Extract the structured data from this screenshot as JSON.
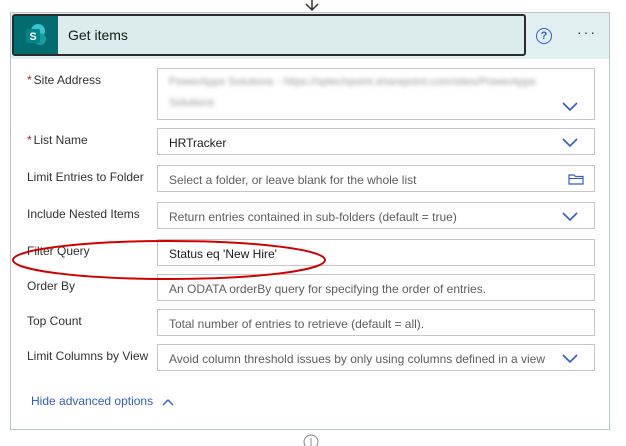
{
  "action": {
    "title": "Get items",
    "icon": "sharepoint-icon",
    "help_symbol": "?",
    "more_symbol": "···"
  },
  "fields": {
    "site_address": {
      "label": "Site Address",
      "required": true,
      "value_line1": "PowerApps Solutions - https://sptechpoint.sharepoint.com/sites/PowerApps",
      "value_line2": "Solutions"
    },
    "list_name": {
      "label": "List Name",
      "required": true,
      "value": "HRTracker"
    },
    "limit_entries_folder": {
      "label": "Limit Entries to Folder",
      "placeholder": "Select a folder, or leave blank for the whole list"
    },
    "include_nested": {
      "label": "Include Nested Items",
      "placeholder": "Return entries contained in sub-folders (default = true)"
    },
    "filter_query": {
      "label": "Filter Query",
      "value": "Status eq 'New Hire'"
    },
    "order_by": {
      "label": "Order By",
      "placeholder": "An ODATA orderBy query for specifying the order of entries."
    },
    "top_count": {
      "label": "Top Count",
      "placeholder": "Total number of entries to retrieve (default = all)."
    },
    "limit_columns": {
      "label": "Limit Columns by View",
      "placeholder": "Avoid column threshold issues by only using columns defined in a view"
    }
  },
  "footer": {
    "hide_advanced_label": "Hide advanced options"
  },
  "colors": {
    "header_bg": "#e1eff0",
    "sharepoint_teal": "#036c70",
    "link_blue": "#2f5ec5",
    "annotation_red": "#d00000",
    "required_red": "#a4262c"
  }
}
